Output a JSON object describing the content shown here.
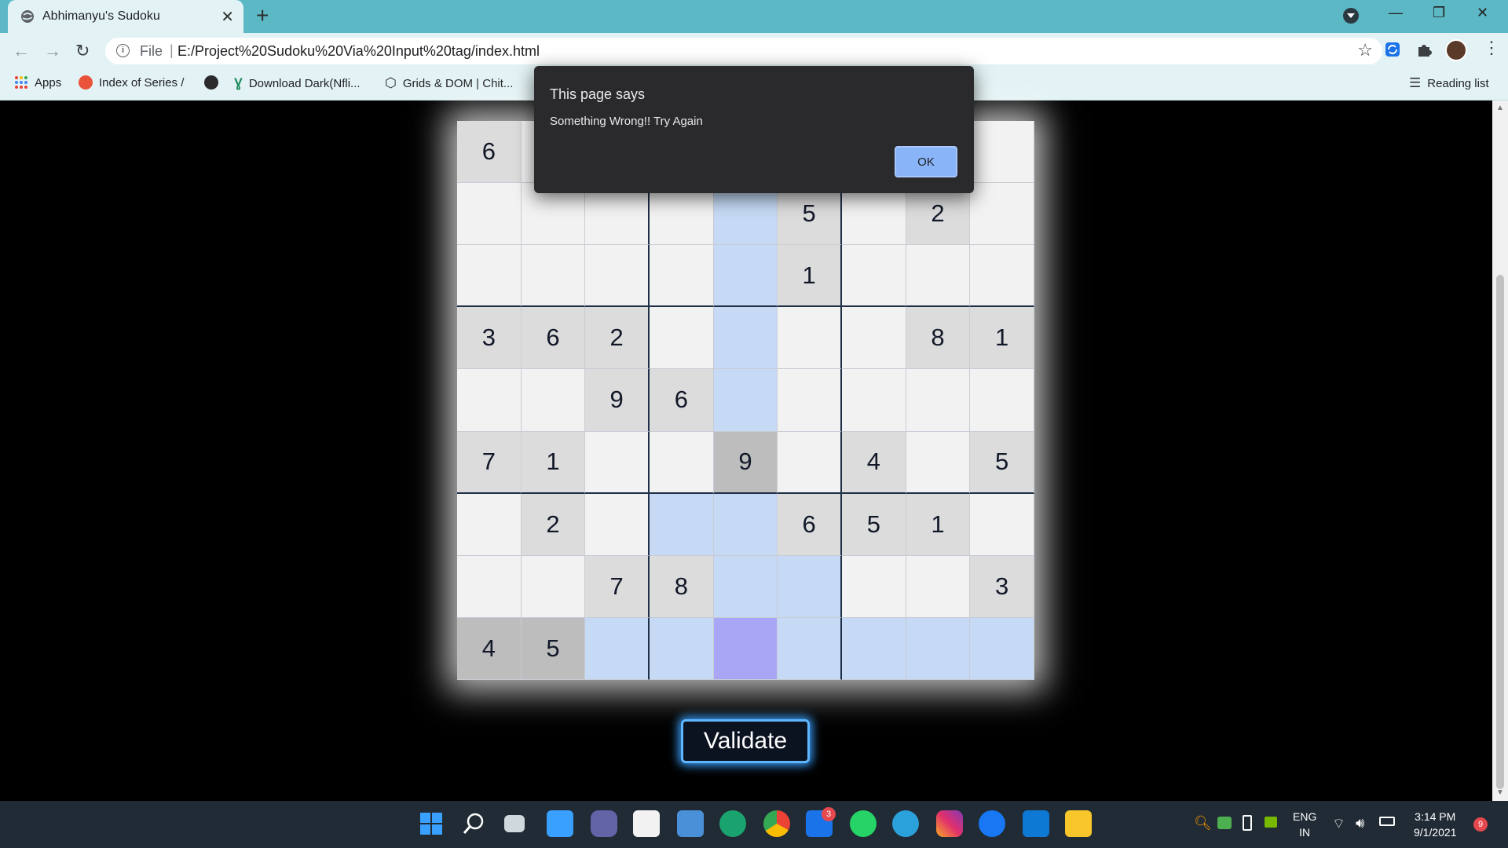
{
  "browser": {
    "tab_title": "Abhimanyu's Sudoku",
    "tab_close": "✕",
    "new_tab": "+",
    "address_scheme": "File",
    "address_url": "E:/Project%20Sudoku%20Via%20Input%20tag/index.html",
    "window_controls": [
      "—",
      "❐",
      "✕"
    ]
  },
  "bookmarks": [
    {
      "label": "Apps",
      "icon": "apps-grid-icon"
    },
    {
      "label": "Index of Series /",
      "icon": "site-icon"
    },
    {
      "label": "",
      "icon": "globe-icon"
    },
    {
      "label": "Download Dark(Nfli...",
      "icon": "yts-icon"
    },
    {
      "label": "Grids & DOM | Chit...",
      "icon": "codepen-icon"
    }
  ],
  "reading_list": "Reading list",
  "sudoku": {
    "grid": [
      [
        "6",
        "",
        "",
        "",
        "",
        "",
        "",
        "",
        ""
      ],
      [
        "",
        "",
        "",
        "",
        "",
        "5",
        "",
        "2",
        ""
      ],
      [
        "",
        "",
        "",
        "",
        "",
        "1",
        "",
        "",
        ""
      ],
      [
        "3",
        "6",
        "2",
        "",
        "",
        "",
        "",
        "8",
        "1"
      ],
      [
        "",
        "",
        "9",
        "6",
        "",
        "",
        "",
        "",
        ""
      ],
      [
        "7",
        "1",
        "",
        "",
        "9",
        "",
        "4",
        "",
        "5"
      ],
      [
        "",
        "2",
        "",
        "",
        "",
        "6",
        "5",
        "1",
        ""
      ],
      [
        "",
        "",
        "7",
        "8",
        "",
        "",
        "",
        "",
        "3"
      ],
      [
        "4",
        "5",
        "",
        "",
        "",
        "",
        "",
        "",
        ""
      ]
    ],
    "selected_cell": [
      8,
      4
    ],
    "validate_label": "Validate"
  },
  "alert": {
    "title": "This page says",
    "message": "Something Wrong!! Try Again",
    "ok_label": "OK"
  },
  "taskbar": {
    "apps": [
      "windows-start-icon",
      "search-icon",
      "task-view-icon",
      "widgets-icon",
      "teams-chat-icon",
      "store-icon",
      "photos-icon",
      "edge-icon",
      "chrome-icon",
      "mail-icon",
      "whatsapp-icon",
      "telegram-icon",
      "instagram-icon",
      "facebook-icon",
      "vscode-icon",
      "file-explorer-icon"
    ],
    "mail_badge": "3",
    "lang_line1": "ENG",
    "lang_line2": "IN",
    "time": "3:14 PM",
    "date": "9/1/2021",
    "notification_count": "9",
    "colors": {
      "accent": "#5bb8c4",
      "alert_button": "#8ab4f8",
      "highlight": "#c6daf6"
    }
  }
}
